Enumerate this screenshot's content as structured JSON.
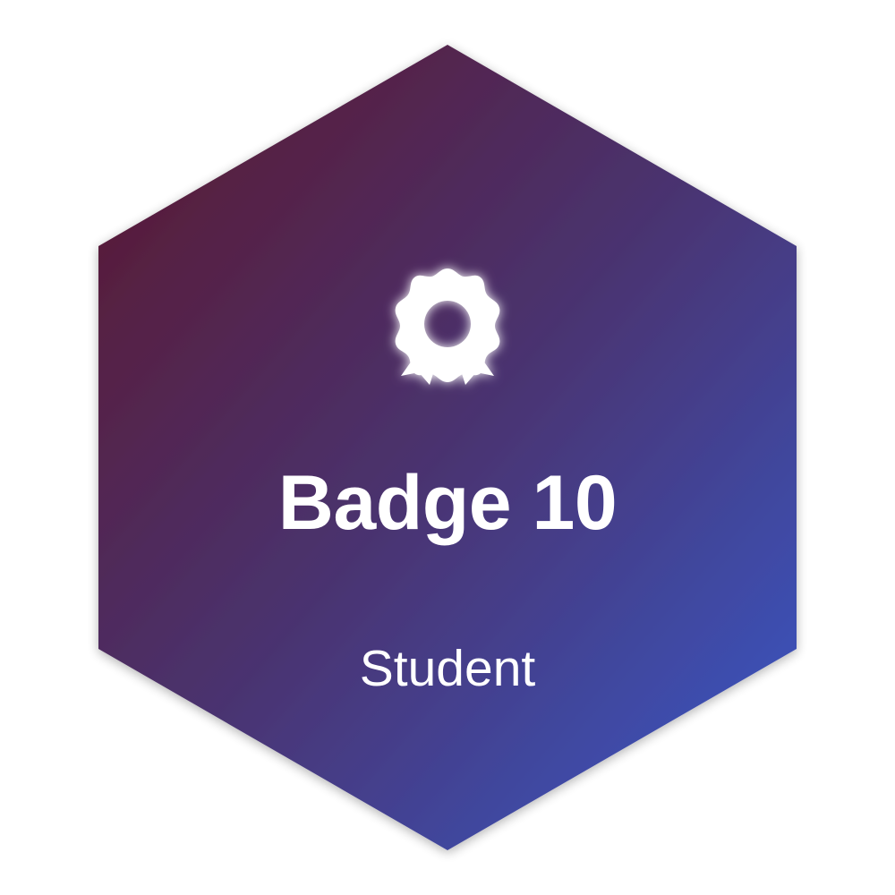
{
  "badge": {
    "title": "Badge 10",
    "role": "Student",
    "icon": "award-ribbon-icon",
    "colors": {
      "gradient_start": "#5a1a34",
      "gradient_mid": "#4a3370",
      "gradient_end": "#3a55bf",
      "text": "#ffffff"
    }
  }
}
